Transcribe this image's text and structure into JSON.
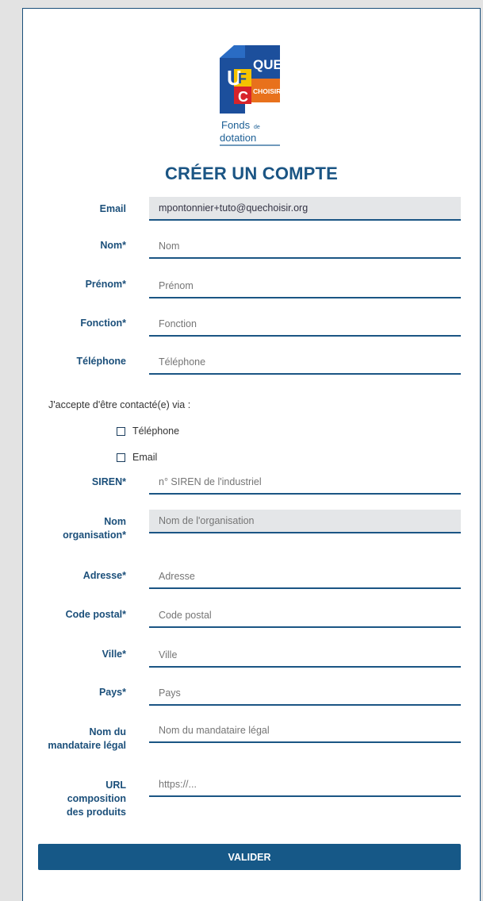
{
  "logo": {
    "letters": [
      "U",
      "F",
      "C"
    ],
    "que": "QUE",
    "choisir": "CHOISIR",
    "line1": "Fonds",
    "de": "de",
    "line2": "dotation"
  },
  "form": {
    "title": "CRÉER UN COMPTE",
    "email": {
      "label": "Email",
      "value": "mpontonnier+tuto@quechoisir.org"
    },
    "nom": {
      "label": "Nom*",
      "placeholder": "Nom"
    },
    "prenom": {
      "label": "Prénom*",
      "placeholder": "Prénom"
    },
    "fonction": {
      "label": "Fonction*",
      "placeholder": "Fonction"
    },
    "telephone": {
      "label": "Téléphone",
      "placeholder": "Téléphone"
    },
    "consent": {
      "text": "J'accepte d'être contacté(e) via :",
      "opt_phone": "Téléphone",
      "opt_email": "Email"
    },
    "siren": {
      "label": "SIREN*",
      "placeholder": "n° SIREN de l'industriel"
    },
    "org": {
      "label_1": "Nom",
      "label_2": "organisation*",
      "placeholder": "Nom de l'organisation"
    },
    "adresse": {
      "label": "Adresse*",
      "placeholder": "Adresse"
    },
    "cp": {
      "label": "Code postal*",
      "placeholder": "Code postal"
    },
    "ville": {
      "label": "Ville*",
      "placeholder": "Ville"
    },
    "pays": {
      "label": "Pays*",
      "placeholder": "Pays"
    },
    "mandataire": {
      "label_1": "Nom du",
      "label_2": "mandataire légal",
      "placeholder": "Nom du mandataire légal"
    },
    "url": {
      "label_1": "URL",
      "label_2": "composition",
      "label_3": "des produits",
      "placeholder": "https://..."
    },
    "submit": "VALIDER"
  },
  "colors": {
    "primary": "#165887",
    "label": "#1b4f7a",
    "readonly_bg": "#e4e6e8"
  }
}
